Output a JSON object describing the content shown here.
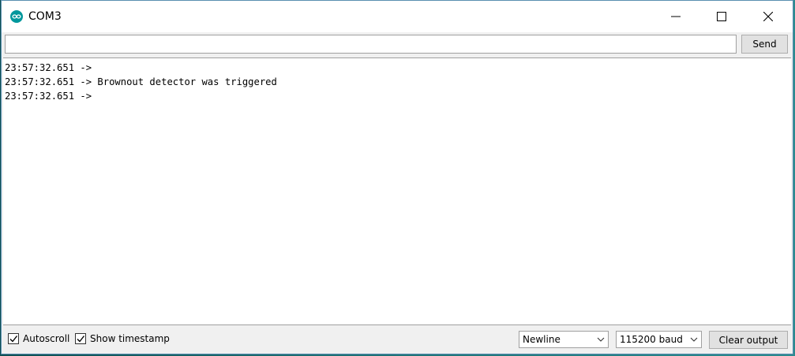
{
  "window": {
    "title": "COM3",
    "app_icon": "arduino-infinity-icon",
    "controls": {
      "minimize_icon": "minimize-icon",
      "maximize_icon": "maximize-icon",
      "close_icon": "close-icon"
    }
  },
  "send_bar": {
    "input_value": "",
    "input_placeholder": "",
    "send_label": "Send"
  },
  "output": {
    "lines": [
      "23:57:32.651 -> ",
      "23:57:32.651 -> Brownout detector was triggered",
      "23:57:32.651 -> "
    ]
  },
  "bottom_bar": {
    "autoscroll": {
      "label": "Autoscroll",
      "checked": true
    },
    "show_timestamp": {
      "label": "Show timestamp",
      "checked": true
    },
    "line_ending": {
      "selected": "Newline"
    },
    "baud_rate": {
      "selected": "115200 baud"
    },
    "clear_label": "Clear output"
  },
  "colors": {
    "accent_icon": "#00979c",
    "window_bg": "#f0f0f0",
    "output_bg": "#ffffff",
    "border": "#a0a0a0"
  }
}
